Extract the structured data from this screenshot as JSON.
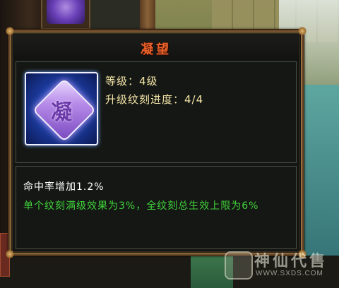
{
  "tooltip": {
    "title": "凝望",
    "icon_char": "凝",
    "level_text": "等级：4级",
    "progress_text": "升级纹刻进度：4/4",
    "effect_text": "命中率增加1.2%",
    "note_text": "单个纹刻满级效果为3%，全纹刻总生效上限为6%",
    "colors": {
      "title": "#e8612a",
      "attributes": "#f1e3a6",
      "effect": "#ffffff",
      "note": "#3fd23a",
      "frame": "#6b4a2a"
    }
  },
  "watermark": {
    "text": "神仙代售",
    "url": "WWW.SXDS.COM"
  },
  "icons": {
    "item": "purple-rune-gem-icon",
    "watermark": "seal-logo-icon"
  }
}
